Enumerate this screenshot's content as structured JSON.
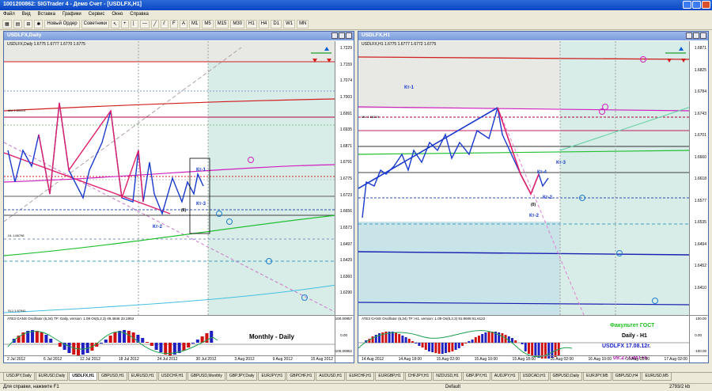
{
  "app": {
    "title": "1001200862: SIGTrader 4 - Демо Счет - [USDLFX,H1]"
  },
  "menu": [
    "Файл",
    "Вид",
    "Вставка",
    "Графики",
    "Сервис",
    "Окно",
    "Справка"
  ],
  "toolbar": {
    "new_order": "Новый Ордер",
    "advisors": "Советники",
    "periods": [
      "M1",
      "M5",
      "M15",
      "M30",
      "H1",
      "H4",
      "D1",
      "W1",
      "MN"
    ]
  },
  "left_window": {
    "title": "USDLFX,Daily",
    "info": "USDLFX,Daily 1.6775 1.6777 1.6770 1.6775",
    "labels": {
      "kt1": "Кт-1",
      "kt3": "Кт-3",
      "kt2": "Кт-2",
      "zero": "(0)",
      "monthly": "Monthly - Daily",
      "mu": "MU 1.69324",
      "ul": "UL 1.66798",
      "sl": "SL1 1.67941"
    },
    "osc_info": "ATE3 GANS Oscillator (5,34) TF: Daily, version: 1.09  Os(5,2,3) 49.4846 33.1953",
    "price_axis": [
      "1.7229",
      "1.7159",
      "1.7074",
      "1.7003",
      "1.6991",
      "1.6935",
      "1.6871",
      "1.6791",
      "1.6775",
      "1.6723",
      "1.6656",
      "1.6573",
      "1.6497",
      "1.6429",
      "1.6360",
      "1.6290"
    ],
    "osc_axis": [
      "100.00957",
      "0.00",
      "-100.00852"
    ],
    "dates": [
      "2 Jul 2012",
      "6 Jul 2012",
      "12 Jul 2012",
      "18 Jul 2012",
      "24 Jul 2012",
      "30 Jul 2012",
      "3 Aug 2012",
      "9 Aug 2012",
      "15 Aug 2012"
    ]
  },
  "right_window": {
    "title": "USDLFX,H1",
    "info": "USDLFX,H1 1.6775 1.6777 1.6772 1.6775",
    "labels": {
      "kt1": "Кт-1",
      "kt4": "Кт-4",
      "kt3": "Кт-3",
      "kt2a": "Кт-2",
      "kt2b": "Кт-2",
      "zero": "(0)",
      "mu": "MU 1.68219"
    },
    "osc_info": "ATE3 GANS Oscillator (5,34) TF: H1, version: 1.09  Os(5,2,3) 91.9608 51.6122",
    "fact": "Факультет ГОСТ",
    "daily": "Daily - H1",
    "usd": "USDLFX 17.08.12г.",
    "time": "09:27  GMT+6",
    "price_axis": [
      "1.6871",
      "1.6825",
      "1.6784",
      "1.6743",
      "1.6701",
      "1.6660",
      "1.6618",
      "1.6577",
      "1.6535",
      "1.6494",
      "1.6452",
      "1.6410"
    ],
    "osc_axis": [
      "100.00",
      "0.00",
      "-100.00"
    ],
    "dates": [
      "14 Aug 2012",
      "14 Aug 18:00",
      "15 Aug 02:00",
      "15 Aug 10:00",
      "15 Aug 18:00",
      "16 Aug 02:00",
      "16 Aug 10:00",
      "16 Aug 18:00",
      "17 Aug 02:00"
    ]
  },
  "tabs": [
    "USDJPY,Daily",
    "EURUSD,Daily",
    "USDLFX,H1",
    "GBPUSD,H1",
    "EURUSD,H1",
    "USDCHF,H1",
    "GBPUSD,Monthly",
    "GBPJPY,Daily",
    "EURJPY,H1",
    "GBPCHF,H1",
    "AUDUSD,H1",
    "EURCHF,H1",
    "EURGBP,H1",
    "CHFJPY,H1",
    "NZDUSD,H1",
    "GBPJPY,H1",
    "AUDJPY,H1",
    "USDCAD,H1",
    "GBPUSD,Daily",
    "EURJPY,M5",
    "GBPUSD,H4",
    "EURUSD,M5"
  ],
  "active_tab": 2,
  "status": {
    "help": "Для справки, нажмите F1",
    "profile": "Default",
    "kb": "2793/2 kb"
  },
  "colors": {
    "accent_blue": "#1a3acc",
    "pink": "#e0206a",
    "green": "#20c030",
    "osc_red": "#d01010",
    "osc_blue": "#2020c0",
    "shade": "#d8ece8"
  }
}
